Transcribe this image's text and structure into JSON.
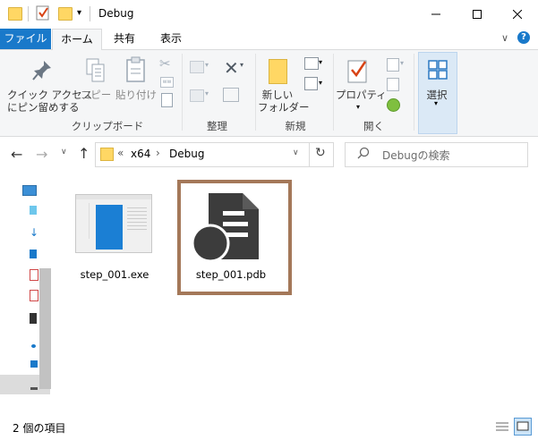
{
  "window": {
    "title": "Debug"
  },
  "tabs": {
    "file": "ファイル",
    "home": "ホーム",
    "share": "共有",
    "view": "表示"
  },
  "ribbon": {
    "pin_label_1": "クイック アクセス",
    "pin_label_2": "にピン留めする",
    "copy": "コピー",
    "paste": "貼り付け",
    "clipboard_group": "クリップボード",
    "organize_group": "整理",
    "new_folder_1": "新しい",
    "new_folder_2": "フォルダー",
    "new_group": "新規",
    "properties": "プロパティ",
    "open_group": "開く",
    "select": "選択"
  },
  "address": {
    "overflow": "«",
    "crumbs": [
      "x64",
      "Debug"
    ]
  },
  "search": {
    "placeholder": "Debugの検索"
  },
  "files": [
    {
      "name": "step_001.exe",
      "icon": "exe-window-icon"
    },
    {
      "name": "step_001.pdb",
      "icon": "pdb-document-icon"
    }
  ],
  "status": {
    "item_count": "2 個の項目"
  },
  "colors": {
    "accent": "#1979ca",
    "selection_border": "#a47859",
    "folder": "#ffd764"
  }
}
